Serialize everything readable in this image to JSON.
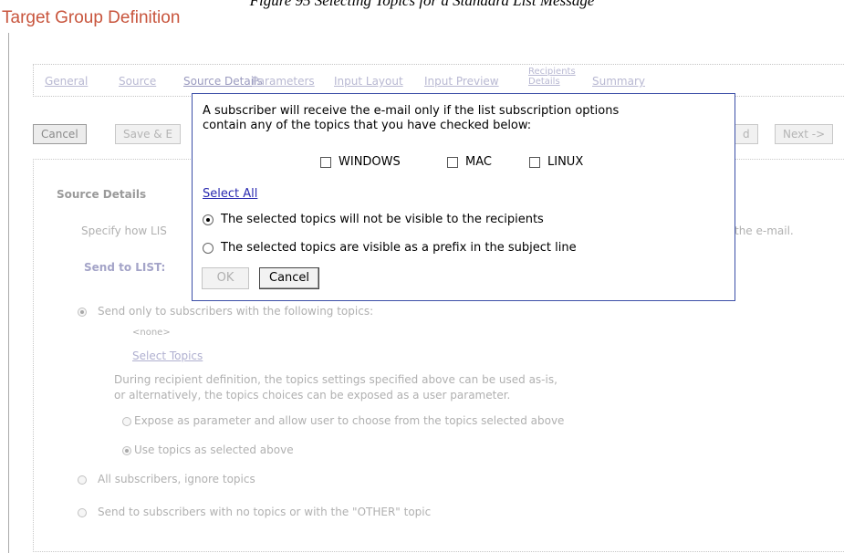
{
  "caption": "Figure 95 Selecting Topics for a Standard List Message",
  "page_title": "Target Group Definition",
  "tabs": [
    {
      "label": "General"
    },
    {
      "label": "Source"
    },
    {
      "label": "Source Details"
    },
    {
      "label": "Parameters"
    },
    {
      "label": "Input Layout"
    },
    {
      "label": "Input Preview"
    },
    {
      "label": "Recipients Details"
    },
    {
      "label": "Summary"
    }
  ],
  "active_tab": "Source Details",
  "toolbar": {
    "cancel_label": "Cancel",
    "save_label": "Save & E",
    "back_partial": "d",
    "next_label": "Next ->"
  },
  "source": {
    "heading": "Source Details",
    "specify_text_start": "Specify how LIS",
    "specify_text_end": "the e-mail.",
    "send_to_label": "Send to LIST:",
    "send_only_label": "Send only to subscribers with the following topics:",
    "none_label": "<none>",
    "select_topics_link": "Select Topics",
    "recipient_note_1": "During recipient definition, the topics settings specified above can be used as-is,",
    "recipient_note_2": "or alternatively, the topics choices can be exposed as a user parameter.",
    "expose_label": "Expose as parameter and allow user to choose from the topics selected above",
    "use_topics_label": "Use topics as selected above",
    "all_subscribers_label": "All subscribers, ignore topics",
    "no_topics_label": "Send to subscribers with no topics or with the \"OTHER\" topic"
  },
  "dialog": {
    "message_line1": "A subscriber will receive the e-mail only if the list subscription options",
    "message_line2": "contain any of the topics that you have checked below:",
    "topics": [
      "WINDOWS",
      "MAC",
      "LINUX"
    ],
    "select_all_label": "Select All",
    "option_hidden_label": "The selected topics will not be visible to the recipients",
    "option_prefix_label": "The selected topics are visible as a prefix in the subject line",
    "selected_option": "hidden",
    "ok_label": "OK",
    "cancel_label": "Cancel"
  },
  "colors": {
    "title": "#c8553d",
    "dialog_border": "#3c4fa8",
    "link": "#2a2ab0"
  }
}
